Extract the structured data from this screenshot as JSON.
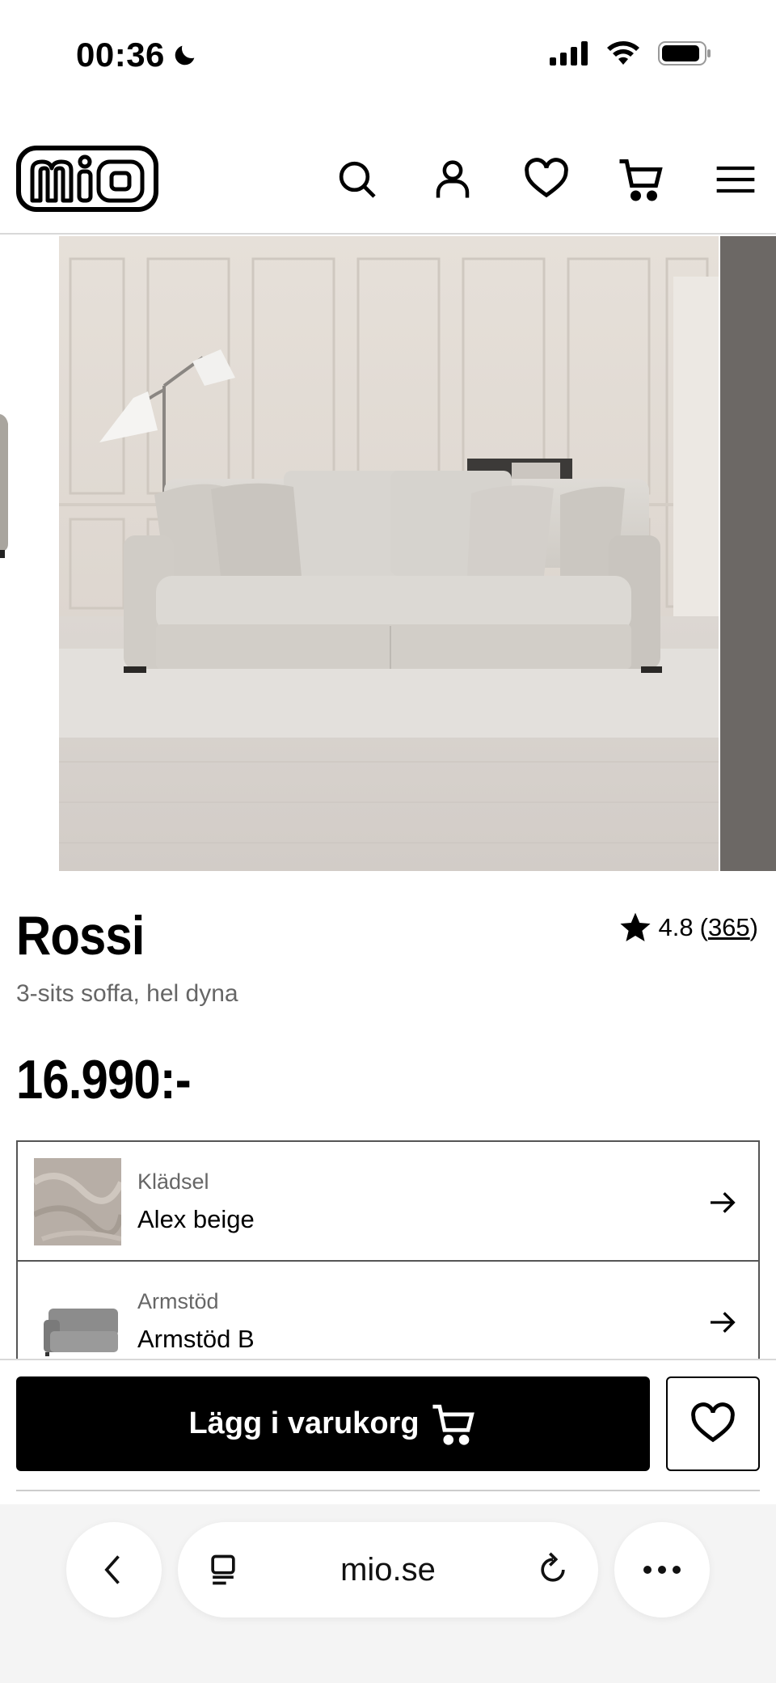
{
  "status": {
    "time": "00:36"
  },
  "header": {
    "logo_text": "mio",
    "icons": [
      "search-icon",
      "account-icon",
      "heart-icon",
      "cart-icon",
      "menu-icon"
    ]
  },
  "product": {
    "title": "Rossi",
    "rating": "4.8",
    "review_count": "365",
    "subtitle": "3-sits soffa, hel dyna",
    "price": "16.990:-"
  },
  "options": [
    {
      "label": "Klädsel",
      "value": "Alex beige"
    },
    {
      "label": "Armstöd",
      "value": "Armstöd B"
    }
  ],
  "actions": {
    "add_to_cart": "Lägg i varukorg"
  },
  "browser": {
    "url": "mio.se"
  },
  "colors": {
    "button_bg": "#000000",
    "background": "#ffffff",
    "subtitle_gray": "#666666"
  }
}
